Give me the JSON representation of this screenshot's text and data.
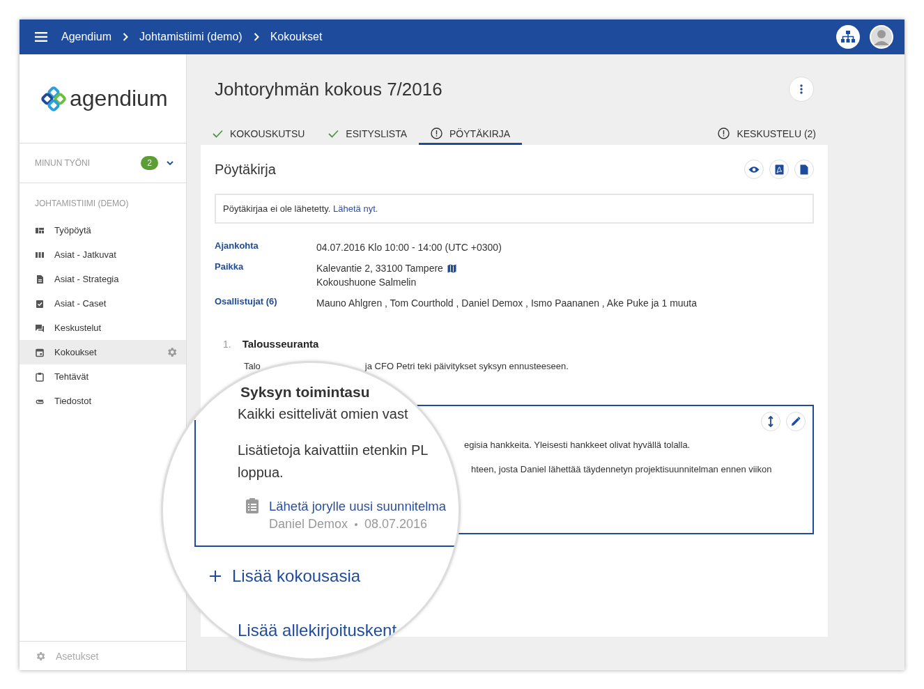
{
  "topbar": {
    "breadcrumbs": [
      "Agendium",
      "Johtamistiimi (demo)",
      "Kokoukset"
    ]
  },
  "sidebar": {
    "logo_text": "agendium",
    "my_work": {
      "label": "MINUN TYÖNI",
      "count": "2",
      "expanded": false
    },
    "section": "JOHTAMISTIIMI (DEMO)",
    "items": [
      {
        "label": "Työpöytä",
        "kind": "dashboard",
        "selected": false
      },
      {
        "label": "Asiat - Jatkuvat",
        "kind": "columns",
        "selected": false
      },
      {
        "label": "Asiat - Strategia",
        "kind": "document",
        "selected": false
      },
      {
        "label": "Asiat - Caset",
        "kind": "checklist",
        "selected": false
      },
      {
        "label": "Keskustelut",
        "kind": "chat",
        "selected": false
      },
      {
        "label": "Kokoukset",
        "kind": "calendar",
        "selected": true
      },
      {
        "label": "Tehtävät",
        "kind": "clipboard",
        "selected": false
      },
      {
        "label": "Tiedostot",
        "kind": "paperclip",
        "selected": false
      }
    ],
    "footer": "Asetukset"
  },
  "meeting": {
    "title": "Johtoryhmän kokous 7/2016",
    "tabs": [
      {
        "label": "KOKOUSKUTSU",
        "kind": "done",
        "selected": false
      },
      {
        "label": "ESITYSLISTA",
        "kind": "done",
        "selected": false
      },
      {
        "label": "PÖYTÄKIRJA",
        "kind": "attention",
        "selected": true
      }
    ],
    "discussion_tab": {
      "label": "KESKUSTELU (2)",
      "kind": "attention",
      "selected": false
    }
  },
  "minutes": {
    "title": "Pöytäkirja",
    "notice": {
      "text": "Pöytäkirjaa ei ole lähetetty.",
      "link": "Lähetä nyt."
    },
    "details": [
      {
        "label": "Ajankohta",
        "kind": "text",
        "lines": [
          "04.07.2016 Klo 10:00 - 14:00 (UTC +0300)"
        ]
      },
      {
        "label": "Paikka",
        "kind": "location",
        "lines": [
          "Kalevantie 2, 33100 Tampere",
          "Kokoushuone Salmelin"
        ]
      },
      {
        "label": "Osallistujat (6)",
        "kind": "text",
        "lines": [
          "Mauno Ahlgren , Tom Courthold , Daniel Demox , Ismo Paananen , Ake Puke ja 1 muuta"
        ]
      }
    ],
    "agenda": [
      {
        "number": "1.",
        "title": "Talousseuranta",
        "summary_start": "Talo",
        "summary_end": "ja CFO Petri teki päivitykset syksyn ennusteeseen."
      }
    ],
    "focused_item": {
      "lines": [
        "egisia hankkeita. Yleisesti hankkeet olivat hyvällä tolalla.",
        "hteen, josta Daniel lähettää täydennetyn projektisuunnitelman ennen viikon"
      ]
    }
  },
  "magnifier": {
    "heading": "Syksyn toimintasu",
    "paragraphs": [
      "Kaikki esittelivät omien vast",
      "Lisätietoja kaivattiin etenkin PL\nloppua."
    ],
    "task": {
      "title": "Lähetä jorylle uusi suunnitelma",
      "assignee": "Daniel Demox",
      "date": "08.07.2016"
    },
    "add_item": "Lisää kokousasia",
    "add_signature": "Lisää allekirjoituskent"
  }
}
